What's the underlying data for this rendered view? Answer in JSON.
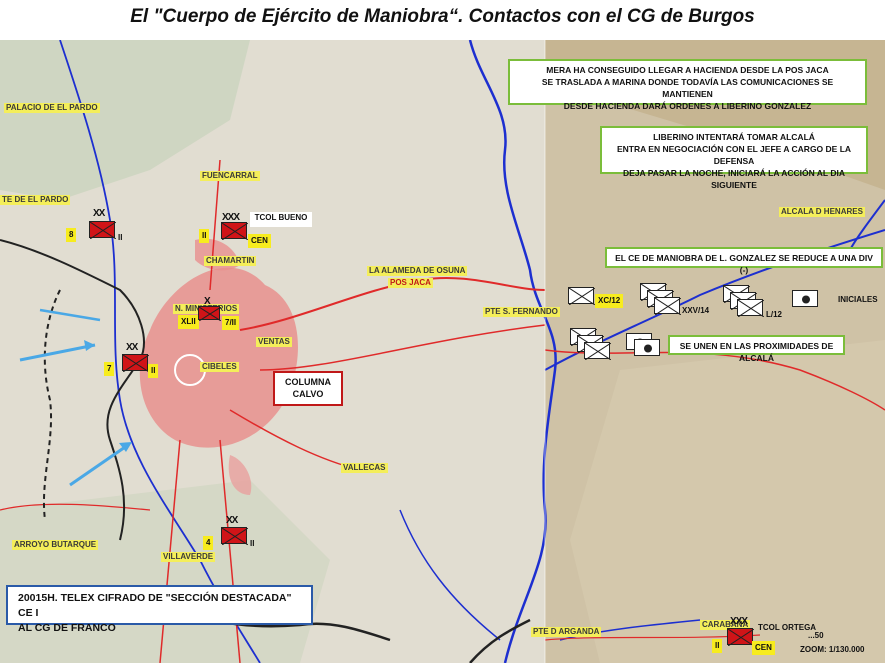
{
  "title": "El \"Cuerpo de Ejército de Maniobra“. Contactos con el CG de Burgos",
  "places": {
    "palacio": "PALACIO DE EL PARDO",
    "el_pardo": "TE DE EL PARDO",
    "fuencarral": "FUENCARRAL",
    "chamartin": "CHAMARTIN",
    "alameda": "LA ALAMEDA DE OSUNA",
    "pos_jaca": "POS JACA",
    "pte_fernando": "PTE S. FERNANDO",
    "ministerios": "N. MINISTERIOS",
    "ventas": "VENTAS",
    "cibeles": "CIBELES",
    "vallecas": "VALLECAS",
    "villaverde": "VILLAVERDE",
    "alcala": "ALCALA D HENARES",
    "arganda": "PTE D ARGANDA",
    "carabana": "CARABAÑA",
    "arroyo": "ARROYO BUTARQUE"
  },
  "notes": {
    "mera": [
      "MERA HA CONSEGUIDO LLEGAR A  HACIENDA DESDE LA POS JACA",
      "SE TRASLADA A MARINA DONDE TODAVÍA LAS COMUNICACIONES SE MANTIENEN",
      "DESDE HACIENDA DARÁ ORDENES A LIBERINO GONZALEZ"
    ],
    "liberino": [
      "LIBERINO INTENTARÁ TOMAR ALCALÁ",
      "ENTRA EN NEGOCIACIÓN CON EL JEFE A CARGO DE LA DEFENSA",
      "DEJA PASAR LA NOCHE, INICIARÁ LA ACCIÓN AL DIA SIGUIENTE"
    ],
    "ce_maniobra": "EL CE DE MANIOBRA DE L. GONZALEZ SE REDUCE A UNA DIV (-)",
    "unen": "SE UNEN EN LAS PROXIMIDADES DE ALCALÁ",
    "columna": [
      "COLUMNA",
      "CALVO"
    ],
    "telex": [
      "20015H. TELEX CIFRADO DE \"SECCIÓN DESTACADA\" CE I",
      "AL  CG DE FRANCO"
    ]
  },
  "units": {
    "u8": {
      "num": "8",
      "rank": "XX",
      "echelon": "II"
    },
    "bueno": {
      "rank": "XXX",
      "echelon": "II",
      "label": "TCOL BUENO",
      "tag": "CEN"
    },
    "xlii": {
      "rank": "X",
      "left": "XLII",
      "right": "7/II"
    },
    "u7": {
      "num": "7",
      "rank": "XX",
      "echelon": "II"
    },
    "u4": {
      "num": "4",
      "rank": "XX",
      "echelon": "II"
    },
    "ortega": {
      "rank": "XXX",
      "echelon": "II",
      "label": "TCOL ORTEGA",
      "tag": "CEN"
    }
  },
  "white_units": {
    "xc": "XC/12",
    "xxv": "XXV/14",
    "l12": "L/12",
    "iniciales": "INICIALES"
  },
  "scale": {
    "line1": "...50",
    "zoom": "ZOOM: 1/130.000"
  },
  "colors": {
    "unit_red": "#d01418",
    "label_yellow": "#f7ec1e",
    "note_green": "#7bbd3a",
    "river_blue": "#1d2fd0"
  }
}
